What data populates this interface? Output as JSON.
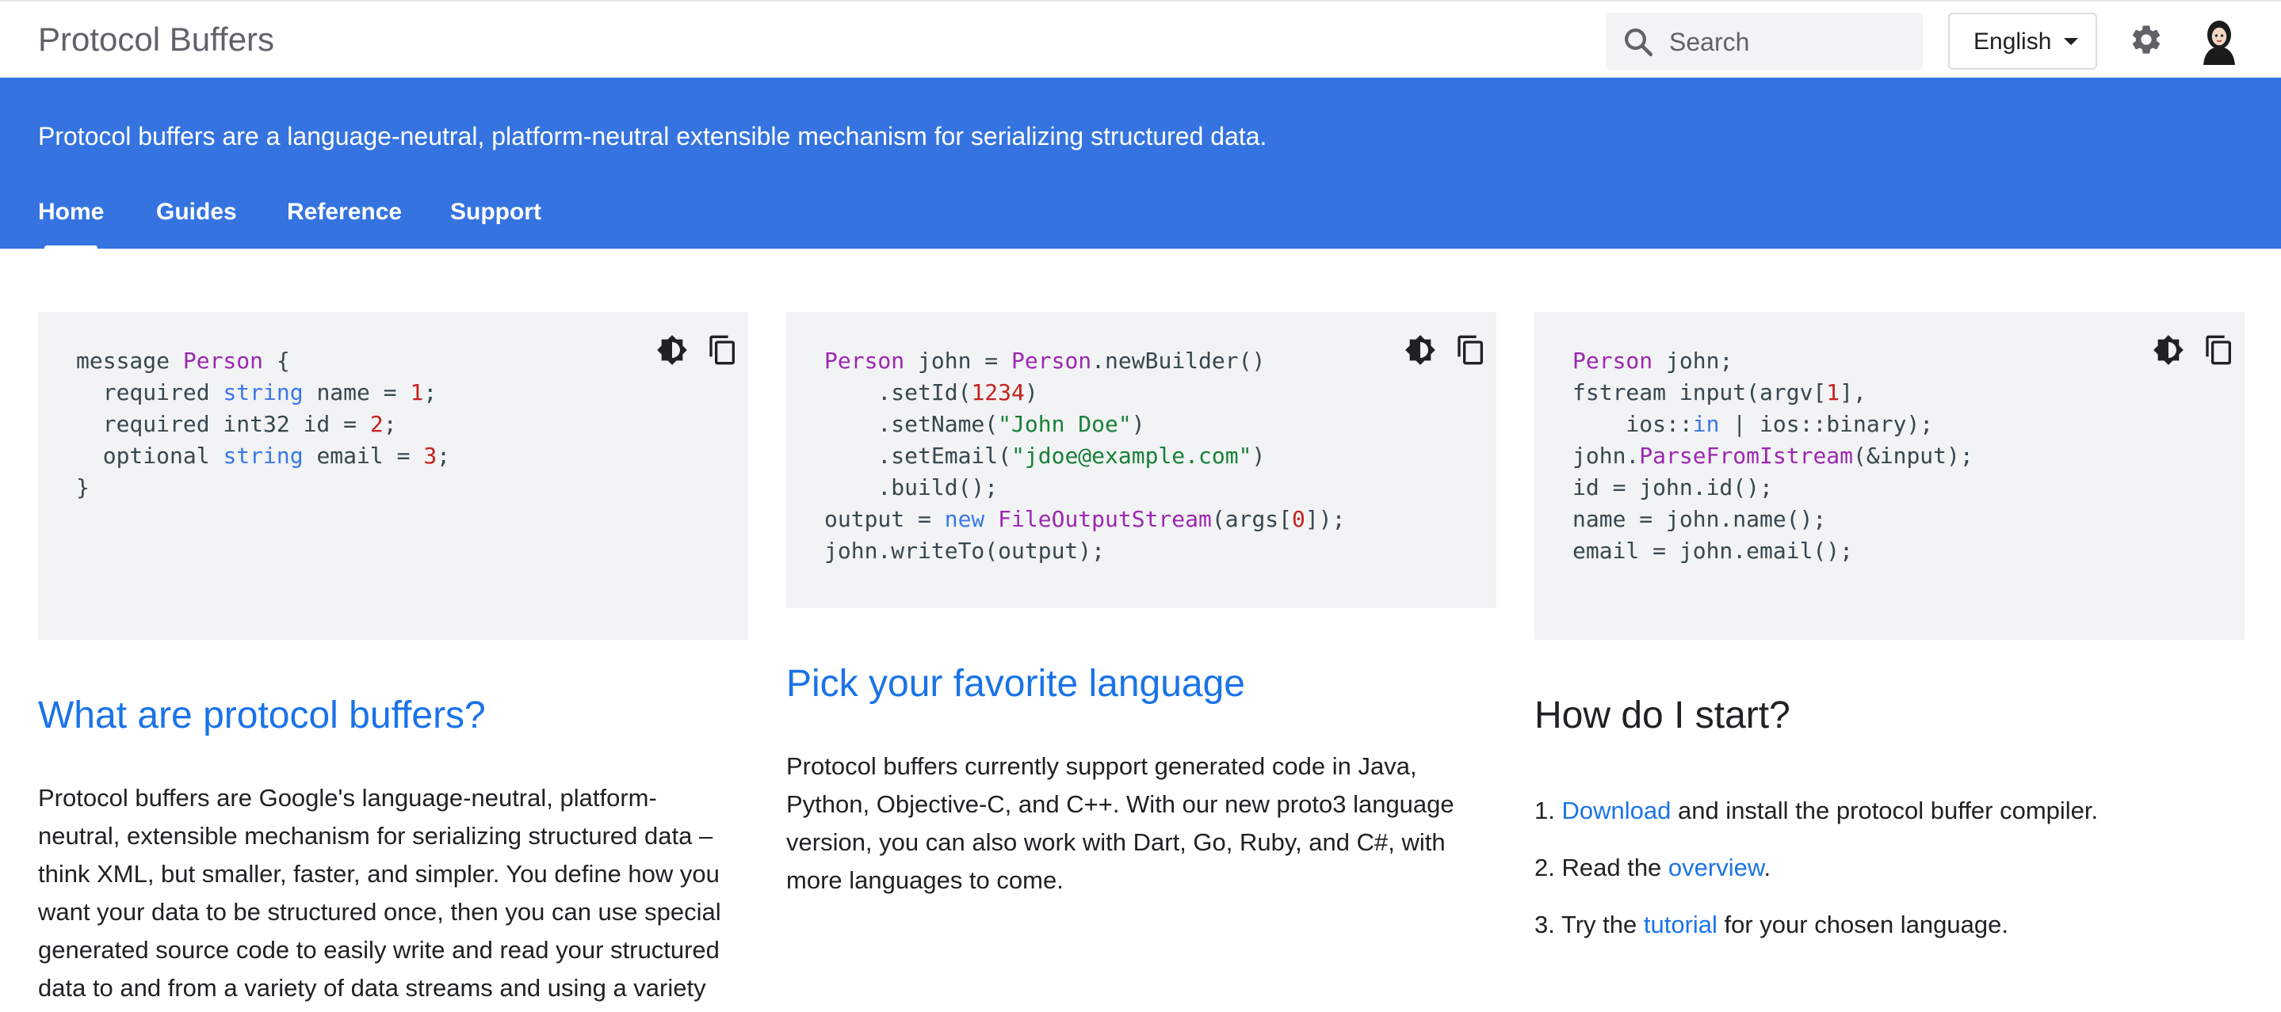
{
  "header": {
    "site_title": "Protocol Buffers",
    "search_placeholder": "Search",
    "language": "English"
  },
  "banner": {
    "tagline": "Protocol buffers are a language-neutral, platform-neutral extensible mechanism for serializing structured data.",
    "tabs": [
      {
        "label": "Home",
        "active": true
      },
      {
        "label": "Guides",
        "active": false
      },
      {
        "label": "Reference",
        "active": false
      },
      {
        "label": "Support",
        "active": false
      }
    ]
  },
  "colors": {
    "brand_blue": "#3574e0",
    "link_blue": "#1a73e8",
    "code_bg": "#f1f3f4"
  },
  "code_samples": [
    {
      "lines": [
        [
          [
            "t",
            "message "
          ],
          [
            "ty",
            "Person"
          ],
          [
            "t",
            " {"
          ]
        ],
        [
          [
            "t",
            "  required "
          ],
          [
            "kw",
            "string"
          ],
          [
            "t",
            " name = "
          ],
          [
            "num",
            "1"
          ],
          [
            "t",
            ";"
          ]
        ],
        [
          [
            "t",
            "  required int32 id = "
          ],
          [
            "num",
            "2"
          ],
          [
            "t",
            ";"
          ]
        ],
        [
          [
            "t",
            "  optional "
          ],
          [
            "kw",
            "string"
          ],
          [
            "t",
            " email = "
          ],
          [
            "num",
            "3"
          ],
          [
            "t",
            ";"
          ]
        ],
        [
          [
            "t",
            "}"
          ]
        ]
      ]
    },
    {
      "lines": [
        [
          [
            "ty",
            "Person"
          ],
          [
            "t",
            " john = "
          ],
          [
            "ty",
            "Person"
          ],
          [
            "t",
            ".newBuilder()"
          ]
        ],
        [
          [
            "t",
            "    .setId("
          ],
          [
            "num",
            "1234"
          ],
          [
            "t",
            ")"
          ]
        ],
        [
          [
            "t",
            "    .setName("
          ],
          [
            "str",
            "\"John Doe\""
          ],
          [
            "t",
            ")"
          ]
        ],
        [
          [
            "t",
            "    .setEmail("
          ],
          [
            "str",
            "\"jdoe@example.com\""
          ],
          [
            "t",
            ")"
          ]
        ],
        [
          [
            "t",
            "    .build();"
          ]
        ],
        [
          [
            "t",
            "output = "
          ],
          [
            "kw",
            "new"
          ],
          [
            "t",
            " "
          ],
          [
            "ty",
            "FileOutputStream"
          ],
          [
            "t",
            "(args["
          ],
          [
            "num",
            "0"
          ],
          [
            "t",
            "]);"
          ]
        ],
        [
          [
            "t",
            "john.writeTo(output);"
          ]
        ]
      ]
    },
    {
      "lines": [
        [
          [
            "ty",
            "Person"
          ],
          [
            "t",
            " john;"
          ]
        ],
        [
          [
            "t",
            "fstream input(argv["
          ],
          [
            "num",
            "1"
          ],
          [
            "t",
            "],"
          ]
        ],
        [
          [
            "t",
            "    ios::"
          ],
          [
            "kw",
            "in"
          ],
          [
            "t",
            " | ios::binary);"
          ]
        ],
        [
          [
            "t",
            "john."
          ],
          [
            "ty",
            "ParseFromIstream"
          ],
          [
            "t",
            "(&input);"
          ]
        ],
        [
          [
            "t",
            "id = john.id();"
          ]
        ],
        [
          [
            "t",
            "name = john.name();"
          ]
        ],
        [
          [
            "t",
            "email = john.email();"
          ]
        ]
      ]
    }
  ],
  "sections": {
    "what": {
      "heading": "What are protocol buffers?",
      "lines": [
        "Protocol buffers are Google's language-neutral, platform-",
        "neutral, extensible mechanism for serializing structured data –",
        "think XML, but smaller, faster, and simpler. You define how you",
        "want your data to be structured once, then you can use special",
        "generated source code to easily write and read your structured",
        "data to and from a variety of data streams and using a variety"
      ]
    },
    "pick": {
      "heading": "Pick your favorite language",
      "lines": [
        "Protocol buffers currently support generated code in Java,",
        "Python, Objective-C, and C++. With our new proto3 language",
        "version, you can also work with Dart, Go, Ruby, and C#, with",
        "more languages to come."
      ]
    },
    "start": {
      "heading": "How do I start?",
      "steps": [
        {
          "num": "1.",
          "pre": "",
          "link": "Download",
          "post": " and install the protocol buffer compiler."
        },
        {
          "num": "2.",
          "pre": "Read the ",
          "link": "overview",
          "post": "."
        },
        {
          "num": "3.",
          "pre": "Try the ",
          "link": "tutorial",
          "post": " for your chosen language."
        }
      ]
    }
  }
}
